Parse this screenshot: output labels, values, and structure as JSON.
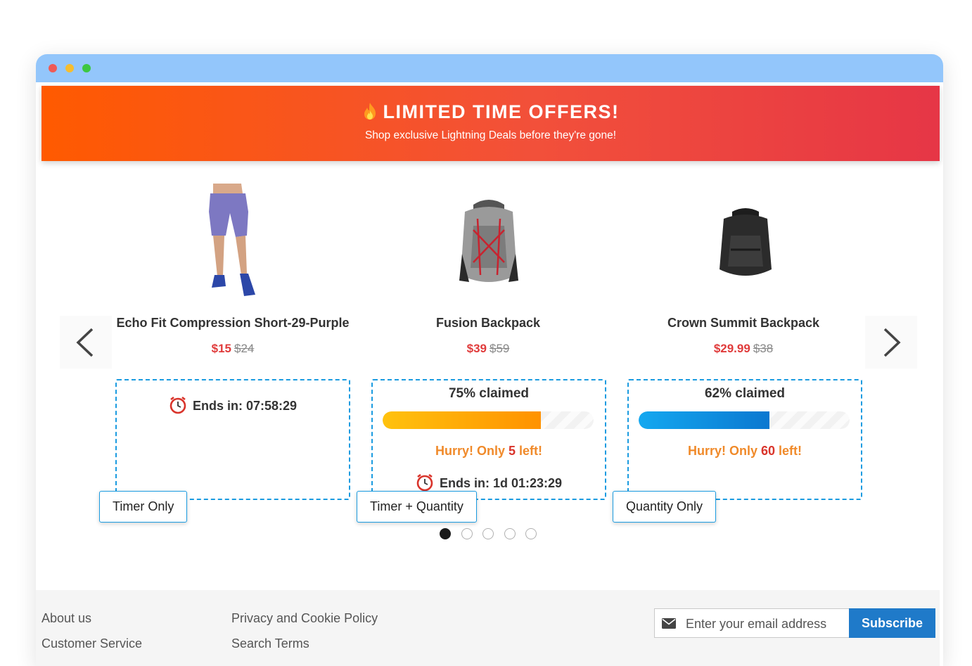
{
  "banner": {
    "title": "LIMITED TIME OFFERS!",
    "subtitle": "Shop exclusive Lightning Deals before they're gone!",
    "gradient": [
      "#ff5a00",
      "#e63646"
    ]
  },
  "carousel": {
    "prev_icon": "chevron-left-icon",
    "next_icon": "chevron-right-icon",
    "page_count": 5,
    "active_page": 1
  },
  "products": [
    {
      "name": "Echo Fit Compression Short-29-Purple",
      "price": "$15",
      "old_price": "$24",
      "timer": "Ends in: 07:58:29",
      "label": "Timer Only"
    },
    {
      "name": "Fusion Backpack",
      "price": "$39",
      "old_price": "$59",
      "claimed": "75% claimed",
      "claimed_fraction": 0.75,
      "hurry_prefix": "Hurry! Only",
      "hurry_count": "5",
      "hurry_suffix": "left!",
      "timer": "Ends in: 1d 01:23:29",
      "label": "Timer + Quantity"
    },
    {
      "name": "Crown Summit Backpack",
      "price": "$29.99",
      "old_price": "$38",
      "claimed": "62% claimed",
      "claimed_fraction": 0.62,
      "hurry_prefix": "Hurry! Only",
      "hurry_count": "60",
      "hurry_suffix": "left!",
      "label": "Quantity Only"
    }
  ],
  "colors": {
    "accent_border": "#1a9be0",
    "price_red": "#e03b3b",
    "bar_orange": "#ffa500",
    "bar_blue": "#0b8fe0",
    "subscribe_blue": "#1f7ac9"
  },
  "footer": {
    "links_col1": [
      "About us",
      "Customer Service"
    ],
    "links_col2": [
      "Privacy and Cookie Policy",
      "Search Terms"
    ],
    "newsletter": {
      "icon": "envelope-icon",
      "placeholder": "Enter your email address",
      "button": "Subscribe"
    }
  }
}
